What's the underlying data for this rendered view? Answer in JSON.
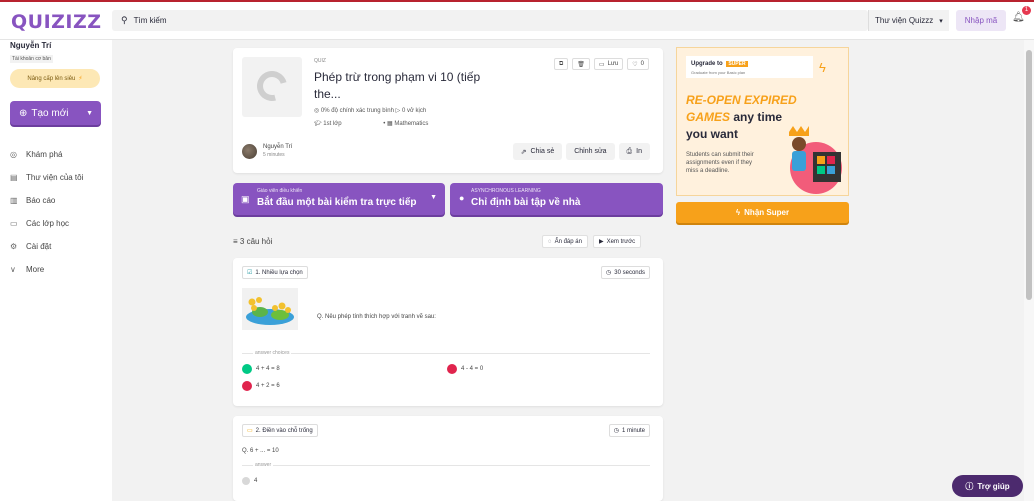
{
  "app": {
    "logo": "QUIZIZZ"
  },
  "topbar": {
    "search_placeholder": "Tìm kiếm",
    "library_select": "Thư viện Quizzz",
    "join_label": "Nhập mã",
    "notification_count": "1"
  },
  "sidebar": {
    "user_name": "Nguyễn Trí",
    "account_type": "Tài khoản cơ bản",
    "upgrade_label": "Nâng cấp lên siêu",
    "create_label": "Tạo mới",
    "nav": [
      {
        "label": "Khám phá",
        "icon": "compass-icon"
      },
      {
        "label": "Thư viện của tôi",
        "icon": "library-icon"
      },
      {
        "label": "Báo cáo",
        "icon": "chart-icon"
      },
      {
        "label": "Các lớp học",
        "icon": "classes-icon"
      },
      {
        "label": "Cài đặt",
        "icon": "gear-icon"
      },
      {
        "label": "More",
        "icon": "chevron-down-icon"
      }
    ]
  },
  "quiz": {
    "type_label": "QUIZ",
    "title": "Phép trừ trong phạm vi 10 (tiếp the...",
    "accuracy": "0% độ chính xác trung bình",
    "plays": "0 vở kịch",
    "grade": "1st lớp",
    "subject": "Mathematics",
    "save_label": "Lưu",
    "like_count": "0",
    "author_name": "Nguyễn Trí",
    "author_time": "5 minutes",
    "share_label": "Chia sẻ",
    "edit_label": "Chỉnh sửa",
    "print_label": "In"
  },
  "assign": {
    "start_small": "Giáo viên điều khiển",
    "start_big": "Bắt đầu một bài kiểm tra trực tiếp",
    "hw_small": "ASYNCHRONOUS LEARNING",
    "hw_big": "Chỉ định bài tập về nhà"
  },
  "questions": {
    "count_label": "3 câu hỏi",
    "hide_answers": "Ẩn đáp án",
    "preview": "Xem trước",
    "q1": {
      "type": "1. Nhiều lựa chọn",
      "time": "30 seconds",
      "text": "Q. Nêu phép tính thích hợp với tranh vẽ sau:",
      "answers_label": "answer choices",
      "choices": [
        {
          "text": "4 + 4 = 8",
          "correct": true
        },
        {
          "text": "4 - 4 = 0",
          "correct": false
        },
        {
          "text": "4 + 2 = 6",
          "correct": false
        }
      ]
    },
    "q2": {
      "type": "2. Điền vào chỗ trống",
      "time": "1 minute",
      "text": "Q. 6 + ... = 10",
      "answer_label": "answer",
      "answer": "4"
    }
  },
  "ad": {
    "upgrade_to": "Upgrade to",
    "super_badge": "SUPER",
    "subtitle": "Graduate from your Basic plan",
    "line1": "RE-OPEN EXPIRED",
    "line2_hl": "GAMES",
    "line2_rest": " any time",
    "line3": "you want",
    "desc": "Students can submit their assignments even if they miss a deadline.",
    "cta": "Nhận Super"
  },
  "help": {
    "label": "Trợ giúp"
  },
  "colors": {
    "primary": "#8854c0",
    "accent": "#f7a11a",
    "correct": "#00c985",
    "incorrect": "#e0244d"
  }
}
